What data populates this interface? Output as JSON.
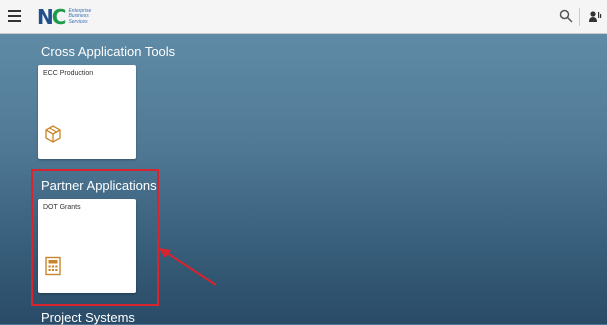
{
  "header": {
    "logo_letters": "NC",
    "logo_lines": [
      "Enterprise",
      "Business",
      "Services"
    ],
    "icons": [
      "menu-icon",
      "search-icon",
      "user-icon"
    ]
  },
  "groups": [
    {
      "title": "Cross Application Tools",
      "tiles": [
        {
          "title": "ECC Production",
          "icon": "cube-box-icon"
        }
      ]
    },
    {
      "title": "Partner Applications",
      "tiles": [
        {
          "title": "DOT Grants",
          "icon": "calculator-icon"
        }
      ]
    },
    {
      "title": "Project Systems",
      "tiles": []
    }
  ],
  "colors": {
    "annotation_red": "#d9232d",
    "tile_icon": "#c9852a",
    "background": "#4c7691"
  }
}
